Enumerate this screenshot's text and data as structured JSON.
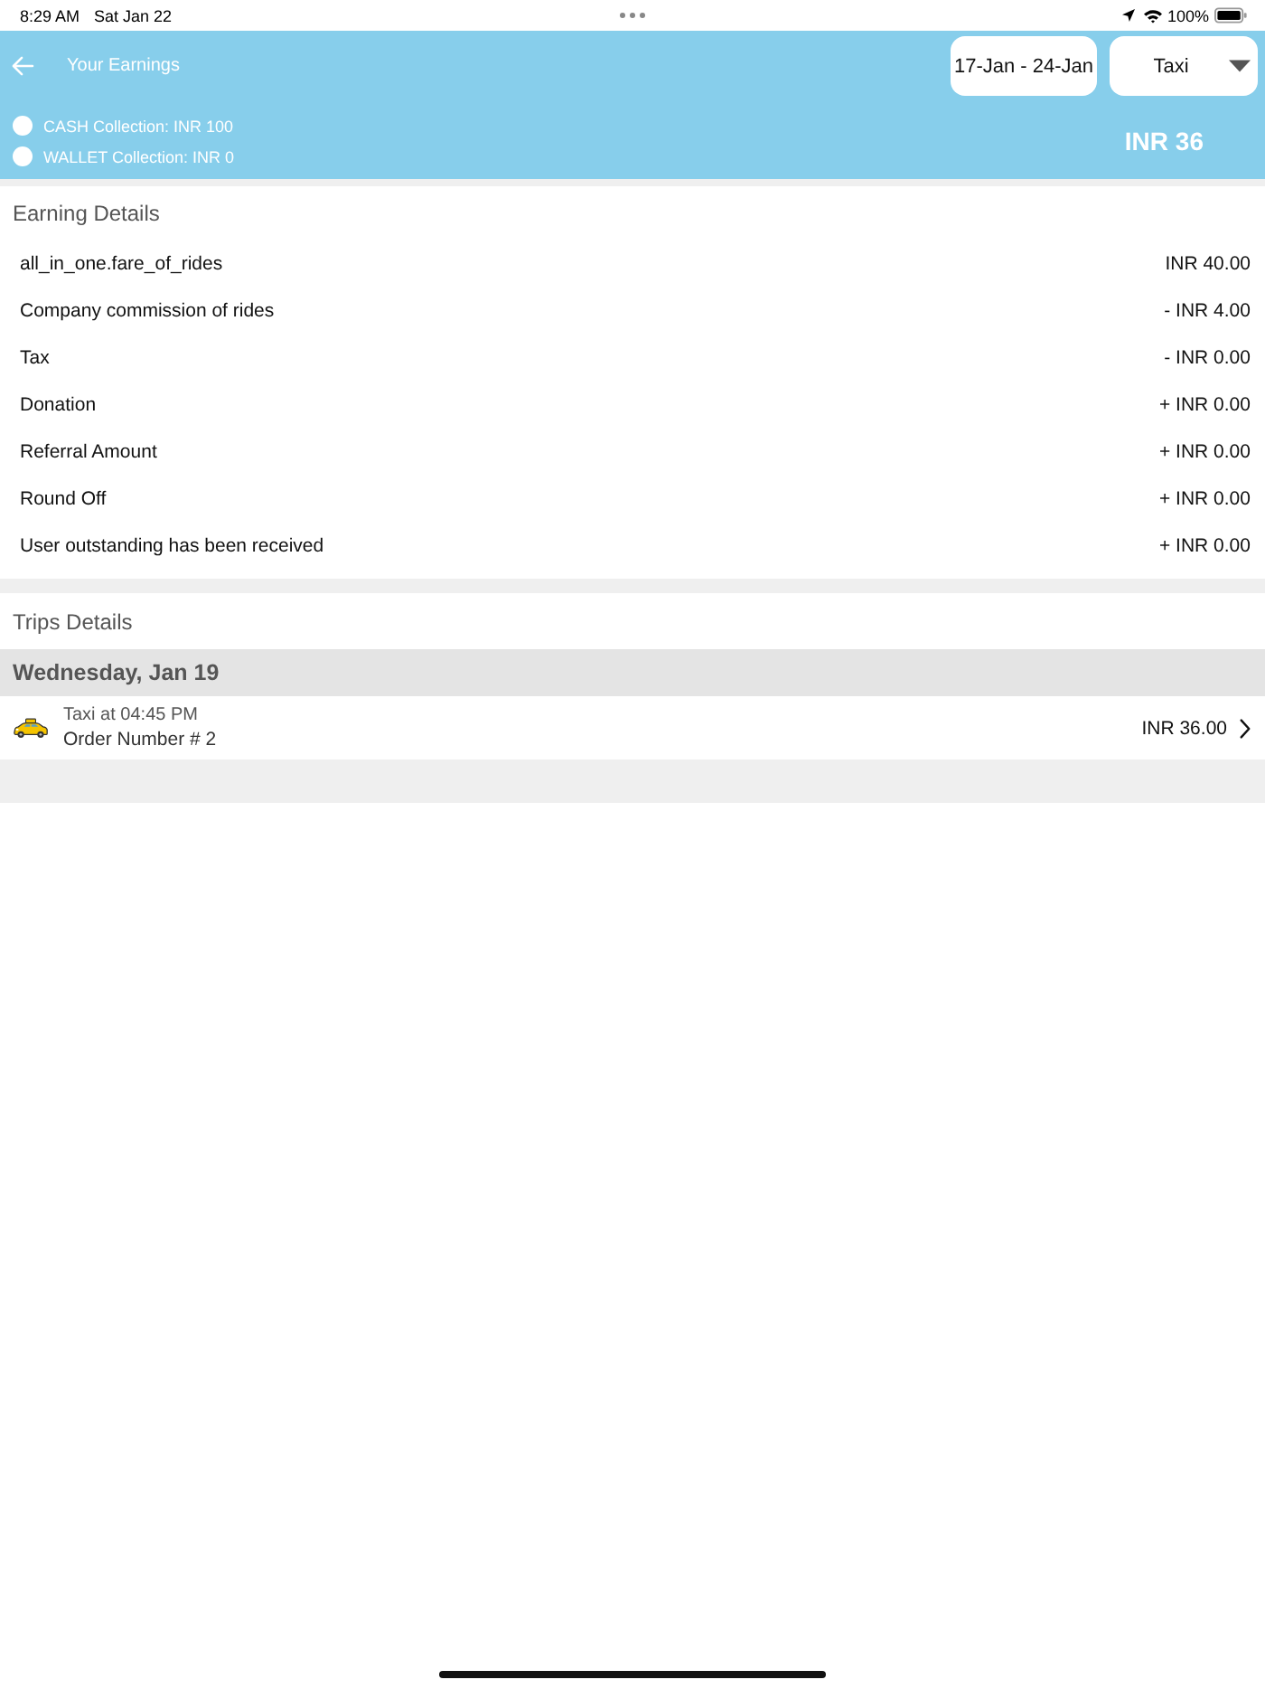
{
  "status_bar": {
    "time": "8:29 AM",
    "date": "Sat Jan 22",
    "battery": "100%"
  },
  "header": {
    "title": "Your Earnings",
    "date_range": "17-Jan - 24-Jan",
    "vehicle_type": "Taxi",
    "collections": [
      "CASH Collection: INR 100",
      "WALLET Collection: INR 0"
    ],
    "total": "INR 36"
  },
  "earning_details": {
    "title": "Earning Details",
    "rows": [
      {
        "label": "all_in_one.fare_of_rides",
        "amount": "INR 40.00"
      },
      {
        "label": "Company commission of rides",
        "amount": "- INR 4.00"
      },
      {
        "label": "Tax",
        "amount": "- INR 0.00"
      },
      {
        "label": "Donation",
        "amount": "+ INR 0.00"
      },
      {
        "label": "Referral Amount",
        "amount": "+ INR 0.00"
      },
      {
        "label": "Round Off",
        "amount": "+ INR 0.00"
      },
      {
        "label": "User outstanding has been received",
        "amount": "+ INR 0.00"
      }
    ]
  },
  "trips_details": {
    "title": "Trips Details",
    "groups": [
      {
        "date": "Wednesday, Jan 19",
        "trips": [
          {
            "title": "Taxi at 04:45 PM",
            "order": "Order Number # 2",
            "amount": "INR 36.00"
          }
        ]
      }
    ]
  }
}
